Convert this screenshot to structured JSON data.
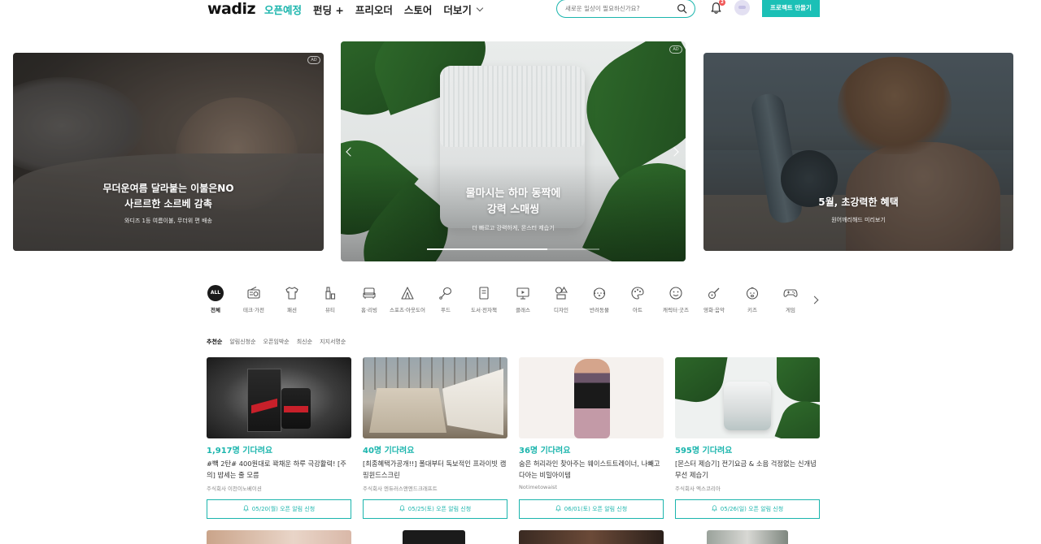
{
  "header": {
    "logo": "wadiz",
    "nav": [
      {
        "label": "오픈예정",
        "active": true
      },
      {
        "label": "펀딩 +",
        "active": false
      },
      {
        "label": "프리오더",
        "active": false
      },
      {
        "label": "스토어",
        "active": false
      },
      {
        "label": "더보기",
        "active": false
      }
    ],
    "search_placeholder": "새로운 일상이 필요하신가요?",
    "notification_count": "2",
    "make_project_label": "프로젝트 만들기",
    "accent_color": "#1bb5ad"
  },
  "banners": {
    "left": {
      "ad": "AD",
      "title_line1": "무더운여름 달라붙는 이불은NO",
      "title_line2": "사르르한 소르베 감촉",
      "subtitle": "와디즈 1등 여름이불, 무더위 편 배송"
    },
    "center": {
      "ad": "AD",
      "title_line1": "물마시는 하마 동짝에",
      "title_line2": "강력 스매씽",
      "subtitle": "더 빠르고 강력하게, 몬스터 제습기",
      "progress": 0.7
    },
    "right": {
      "title": "5월, 초강력한 혜택",
      "subtitle": "원어깨리해드 미리보기"
    }
  },
  "categories": [
    {
      "label": "전체",
      "icon": "all-icon",
      "active": true
    },
    {
      "label": "테크·가전",
      "icon": "radio-icon",
      "active": false
    },
    {
      "label": "패션",
      "icon": "tshirt-icon",
      "active": false
    },
    {
      "label": "뷰티",
      "icon": "cosmetic-icon",
      "active": false
    },
    {
      "label": "홈·리빙",
      "icon": "sofa-icon",
      "active": false
    },
    {
      "label": "스포츠·아웃도어",
      "icon": "tent-icon",
      "active": false
    },
    {
      "label": "푸드",
      "icon": "chicken-leg-icon",
      "active": false
    },
    {
      "label": "도서·전자책",
      "icon": "book-icon",
      "active": false
    },
    {
      "label": "클래스",
      "icon": "monitor-icon",
      "active": false
    },
    {
      "label": "디자인",
      "icon": "shapes-icon",
      "active": false
    },
    {
      "label": "반려동물",
      "icon": "dog-icon",
      "active": false
    },
    {
      "label": "아트",
      "icon": "palette-icon",
      "active": false
    },
    {
      "label": "캐릭터·굿즈",
      "icon": "smile-icon",
      "active": false
    },
    {
      "label": "영화·음악",
      "icon": "guitar-icon",
      "active": false
    },
    {
      "label": "키즈",
      "icon": "baby-icon",
      "active": false
    },
    {
      "label": "게임",
      "icon": "gamepad-icon",
      "active": false
    }
  ],
  "sort": [
    {
      "label": "추천순",
      "active": true
    },
    {
      "label": "알림신청순",
      "active": false
    },
    {
      "label": "오픈임박순",
      "active": false
    },
    {
      "label": "최신순",
      "active": false
    },
    {
      "label": "지지서명순",
      "active": false
    }
  ],
  "cards": [
    {
      "count": "1,917명 기다려요",
      "title": "#빽 2탄# 400원대로 꽉채운 하루 극강활력! [주의] 밥세는 줄 모름",
      "maker": "주식회사 이천이노베이션",
      "alarm": "05/20(월) 오픈 알림 신청"
    },
    {
      "count": "40명 기다려요",
      "title": "[최종혜택가공개!!] 폴대부터 독보적인 프라이빗 캠핑윈드스크린",
      "maker": "주식회사 엔듀러스앤엔드크래프트",
      "alarm": "05/25(토) 오픈 알림 신청"
    },
    {
      "count": "36명 기다려요",
      "title": "숨은 허리라인 찾아주는 웨이스트트레이너, 나빼고 다아는 비밀아이템",
      "maker": "Notimetowaist",
      "alarm": "06/01(토) 오픈 알림 신청"
    },
    {
      "count": "595명 기다려요",
      "title": "[몬스터 제습기] 전기요금 & 소음 걱정없는 신개념 무선 제습기",
      "maker": "주식회사 엑스코리아",
      "alarm": "05/26(일) 오픈 알림 신청"
    }
  ]
}
